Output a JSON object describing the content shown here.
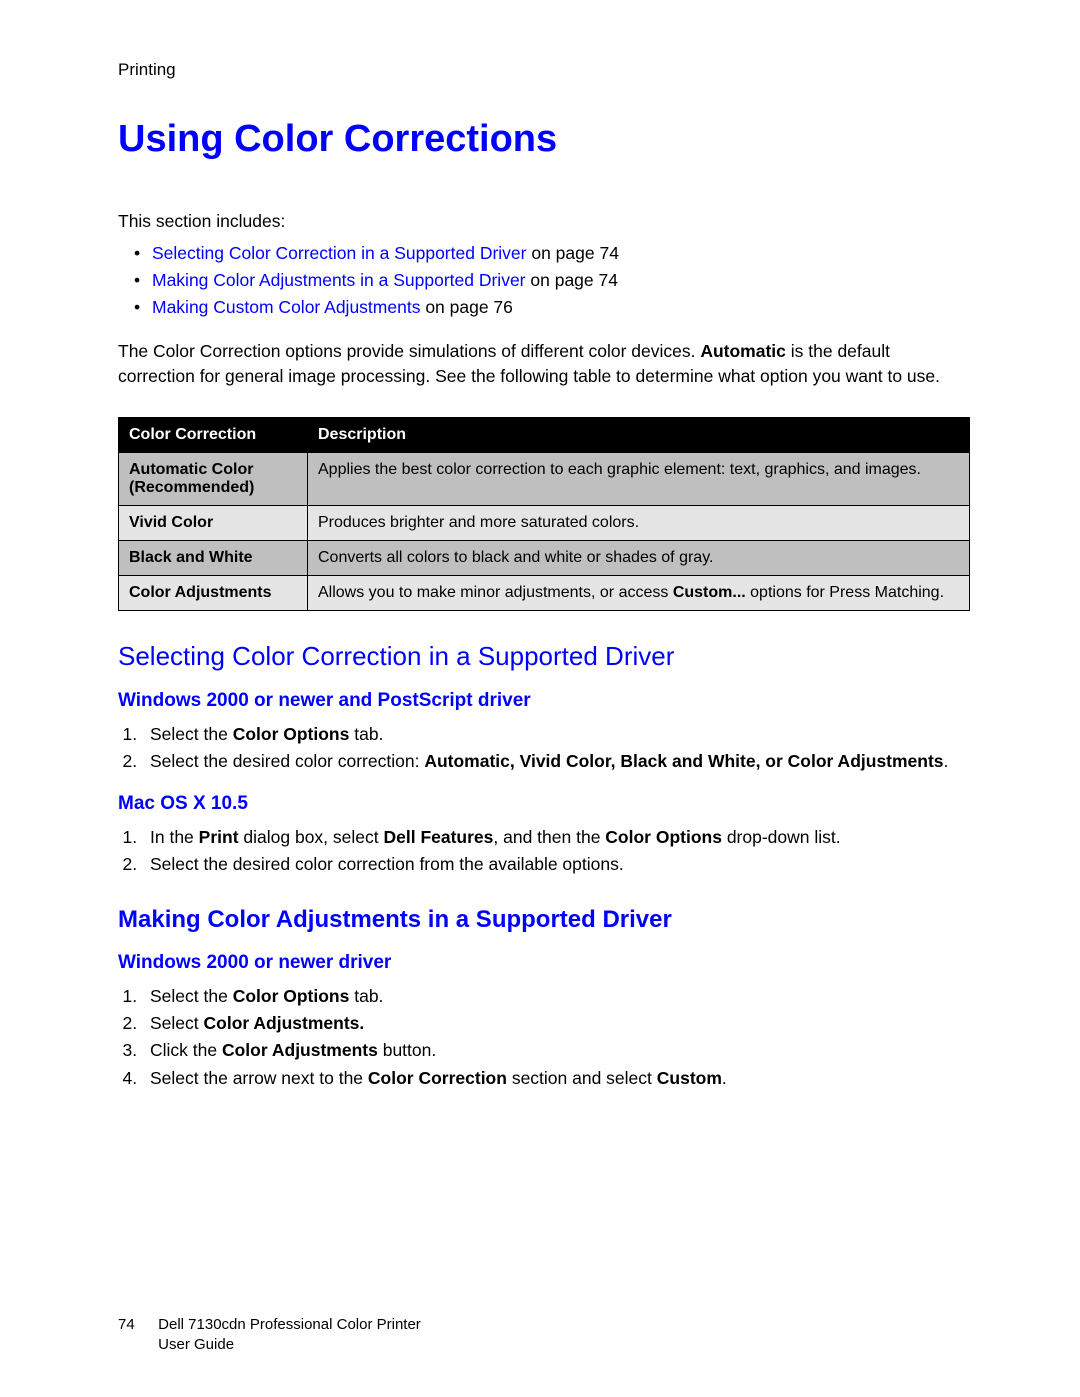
{
  "header": {
    "section": "Printing"
  },
  "title": "Using Color Corrections",
  "intro": "This section includes:",
  "toc": [
    {
      "link": "Selecting Color Correction in a Supported Driver",
      "suffix": " on page 74"
    },
    {
      "link": "Making Color Adjustments in a Supported Driver",
      "suffix": " on page 74"
    },
    {
      "link": "Making Custom Color Adjustments",
      "suffix": " on page 76"
    }
  ],
  "overview_pre": "The Color Correction options provide simulations of different color devices. ",
  "overview_bold": "Automatic",
  "overview_post": " is the default correction for general image processing. See the following table to determine what option you want to use.",
  "table": {
    "head": {
      "c1": "Color Correction",
      "c2": "Description"
    },
    "rows": [
      {
        "label": "Automatic Color (Recommended)",
        "desc": "Applies the best color correction to each graphic element: text, graphics, and images."
      },
      {
        "label": "Vivid Color",
        "desc": "Produces brighter and more saturated colors."
      },
      {
        "label": "Black and White",
        "desc": "Converts all colors to black and white or shades of gray."
      },
      {
        "label": "Color Adjustments",
        "desc_pre": "Allows you to make minor adjustments, or access ",
        "desc_bold": "Custom...",
        "desc_post": " options for Press Matching."
      }
    ]
  },
  "s1": {
    "title": "Selecting Color Correction in a Supported Driver",
    "win": {
      "title": "Windows 2000 or newer and PostScript driver",
      "steps": {
        "s1_pre": "Select the ",
        "s1_b": "Color Options",
        "s1_post": " tab.",
        "s2_pre": "Select the desired color correction: ",
        "s2_b": "Automatic, Vivid Color, Black and White, or Color Adjustments",
        "s2_post": "."
      }
    },
    "mac": {
      "title": "Mac OS X 10.5",
      "steps": {
        "s1_a": "In the ",
        "s1_b": "Print",
        "s1_c": " dialog box, select ",
        "s1_d": "Dell Features",
        "s1_e": ", and then the ",
        "s1_f": "Color Options",
        "s1_g": " drop-down list.",
        "s2": "Select the desired color correction from the available options."
      }
    }
  },
  "s2": {
    "title": "Making Color Adjustments in a Supported Driver",
    "win": {
      "title": "Windows 2000 or newer driver",
      "steps": {
        "s1_pre": "Select the ",
        "s1_b": "Color Options",
        "s1_post": " tab.",
        "s2_pre": "Select ",
        "s2_b": "Color Adjustments.",
        "s3_pre": "Click the ",
        "s3_b": "Color Adjustments",
        "s3_post": " button.",
        "s4_pre": "Select the arrow next to the ",
        "s4_b": "Color Correction",
        "s4_mid": " section and select ",
        "s4_b2": "Custom",
        "s4_post": "."
      }
    }
  },
  "footer": {
    "page": "74",
    "line1": "Dell 7130cdn Professional Color Printer",
    "line2": "User Guide"
  }
}
